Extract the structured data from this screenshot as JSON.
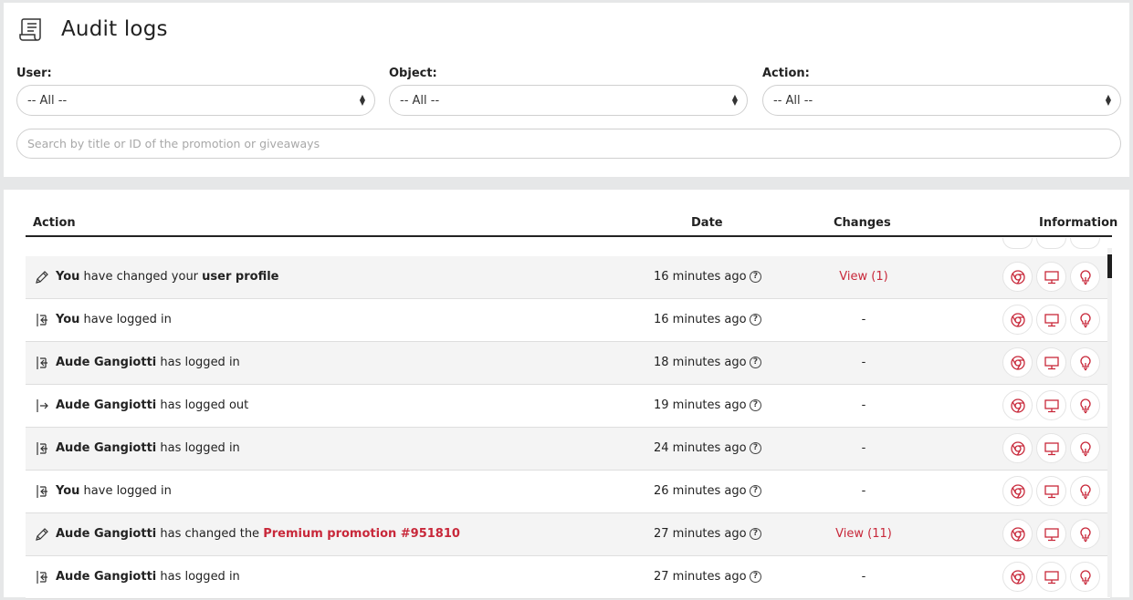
{
  "page": {
    "title": "Audit logs"
  },
  "filters": {
    "user": {
      "label": "User:",
      "value": "-- All --"
    },
    "object": {
      "label": "Object:",
      "value": "-- All --"
    },
    "action": {
      "label": "Action:",
      "value": "-- All --"
    }
  },
  "search": {
    "placeholder": "Search by title or ID of the promotion or giveaways"
  },
  "table": {
    "headers": {
      "action": "Action",
      "date": "Date",
      "changes": "Changes",
      "information": "Information"
    },
    "rows": [
      {
        "icon": "pencil-icon",
        "parts": [
          {
            "t": "You",
            "b": true
          },
          {
            "t": " have changed your "
          },
          {
            "t": "user profile",
            "b": true
          }
        ],
        "date": "16 minutes ago",
        "changes": "View (1)",
        "changes_link": true
      },
      {
        "icon": "login-icon",
        "parts": [
          {
            "t": "You",
            "b": true
          },
          {
            "t": " have logged in"
          }
        ],
        "date": "16 minutes ago",
        "changes": "-",
        "changes_link": false
      },
      {
        "icon": "login-icon",
        "parts": [
          {
            "t": "Aude Gangiotti",
            "b": true
          },
          {
            "t": " has logged in"
          }
        ],
        "date": "18 minutes ago",
        "changes": "-",
        "changes_link": false
      },
      {
        "icon": "logout-icon",
        "parts": [
          {
            "t": "Aude Gangiotti",
            "b": true
          },
          {
            "t": " has logged out"
          }
        ],
        "date": "19 minutes ago",
        "changes": "-",
        "changes_link": false
      },
      {
        "icon": "login-icon",
        "parts": [
          {
            "t": "Aude Gangiotti",
            "b": true
          },
          {
            "t": " has logged in"
          }
        ],
        "date": "24 minutes ago",
        "changes": "-",
        "changes_link": false
      },
      {
        "icon": "login-icon",
        "parts": [
          {
            "t": "You",
            "b": true
          },
          {
            "t": " have logged in"
          }
        ],
        "date": "26 minutes ago",
        "changes": "-",
        "changes_link": false
      },
      {
        "icon": "pencil-icon",
        "parts": [
          {
            "t": "Aude Gangiotti",
            "b": true
          },
          {
            "t": " has changed the "
          },
          {
            "t": "Premium promotion #951810",
            "link": true
          }
        ],
        "date": "27 minutes ago",
        "changes": "View (11)",
        "changes_link": true
      },
      {
        "icon": "login-icon",
        "parts": [
          {
            "t": "Aude Gangiotti",
            "b": true
          },
          {
            "t": " has logged in"
          }
        ],
        "date": "27 minutes ago",
        "changes": "-",
        "changes_link": false
      }
    ],
    "help_glyph": "?",
    "info_icons": [
      "chrome-icon",
      "desktop-icon",
      "lightbulb-icon"
    ]
  },
  "colors": {
    "accent": "#c8283a"
  }
}
